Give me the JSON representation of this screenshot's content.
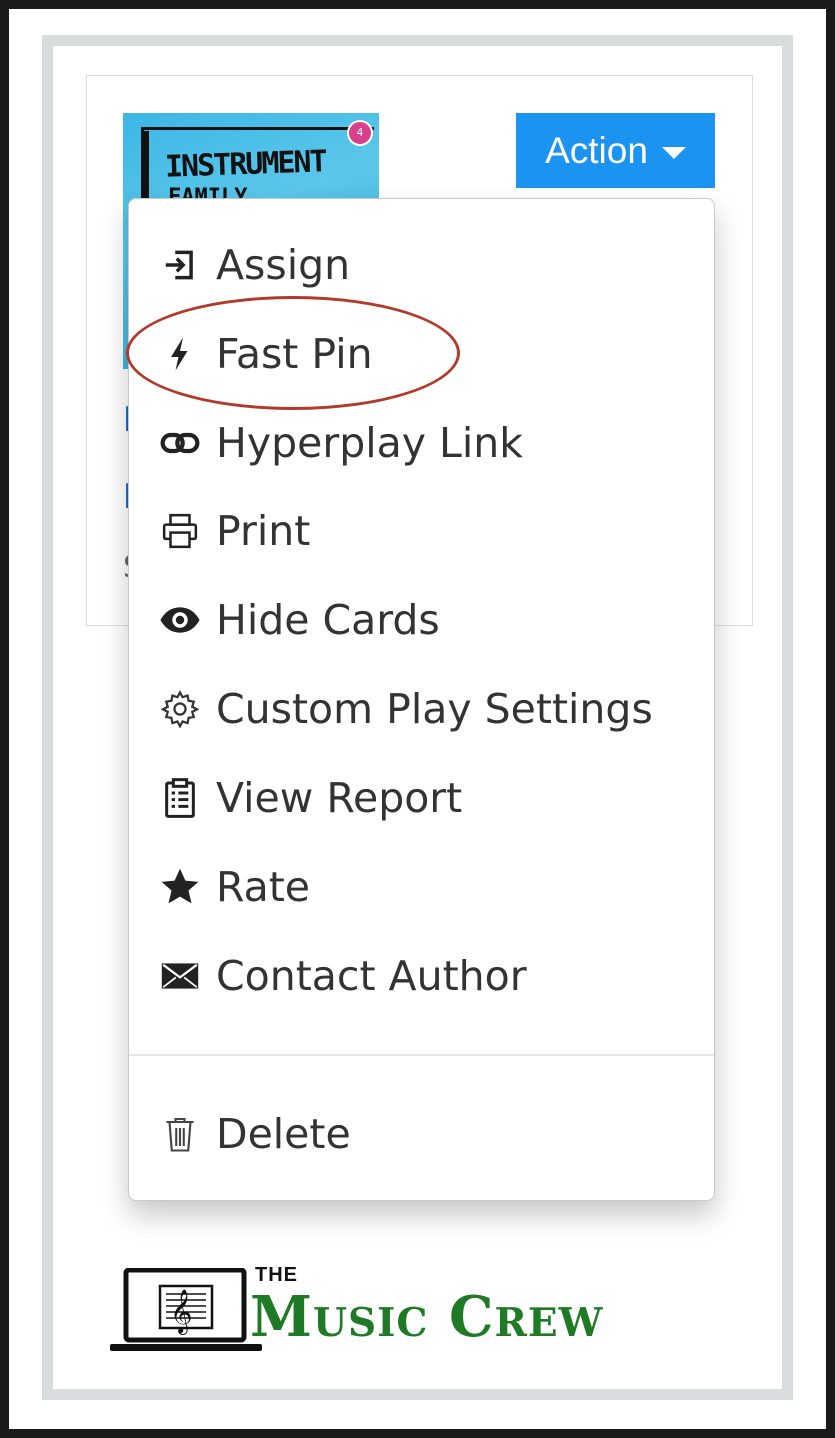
{
  "action_button": {
    "label": "Action"
  },
  "thumbnail": {
    "title": "INSTRUMENT",
    "subtitle": "FAMILY",
    "badge": "4"
  },
  "card_peek_text": [
    "I",
    "I",
    "S"
  ],
  "menu": {
    "items": [
      {
        "label": "Assign",
        "icon": "sign-in-icon"
      },
      {
        "label": "Fast Pin",
        "icon": "lightning-bolt-icon"
      },
      {
        "label": "Hyperplay Link",
        "icon": "link-icon"
      },
      {
        "label": "Print",
        "icon": "printer-icon"
      },
      {
        "label": "Hide Cards",
        "icon": "eye-icon"
      },
      {
        "label": "Custom Play Settings",
        "icon": "gear-icon"
      },
      {
        "label": "View Report",
        "icon": "clipboard-icon"
      },
      {
        "label": "Rate",
        "icon": "star-icon"
      },
      {
        "label": "Contact Author",
        "icon": "envelope-icon"
      }
    ],
    "delete": {
      "label": "Delete",
      "icon": "trash-icon"
    }
  },
  "highlighted_item": "Fast Pin",
  "logo": {
    "small": "THE",
    "name": "Music Crew"
  },
  "colors": {
    "action_button": "#1b93f0",
    "highlight_ellipse": "#b23a2a",
    "logo_green": "#1e7a24",
    "frame_dark": "#1a1a1a",
    "frame_gray": "#d9dcdc"
  }
}
